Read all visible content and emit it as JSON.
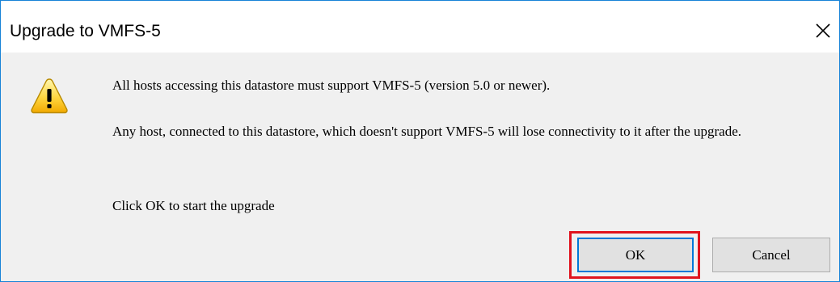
{
  "window": {
    "title": "Upgrade to VMFS-5",
    "close_icon": "close-icon",
    "border_color": "#1883d7"
  },
  "message": {
    "icon": "warning-icon",
    "line1": "All hosts accessing this datastore must support VMFS-5 (version 5.0 or newer).",
    "line2": "Any host, connected to this datastore, which doesn't support VMFS-5 will lose connectivity to it after the upgrade.",
    "line3": "Click OK to start the upgrade"
  },
  "buttons": {
    "ok_label": "OK",
    "cancel_label": "Cancel",
    "highlight_color": "#e0141e"
  }
}
